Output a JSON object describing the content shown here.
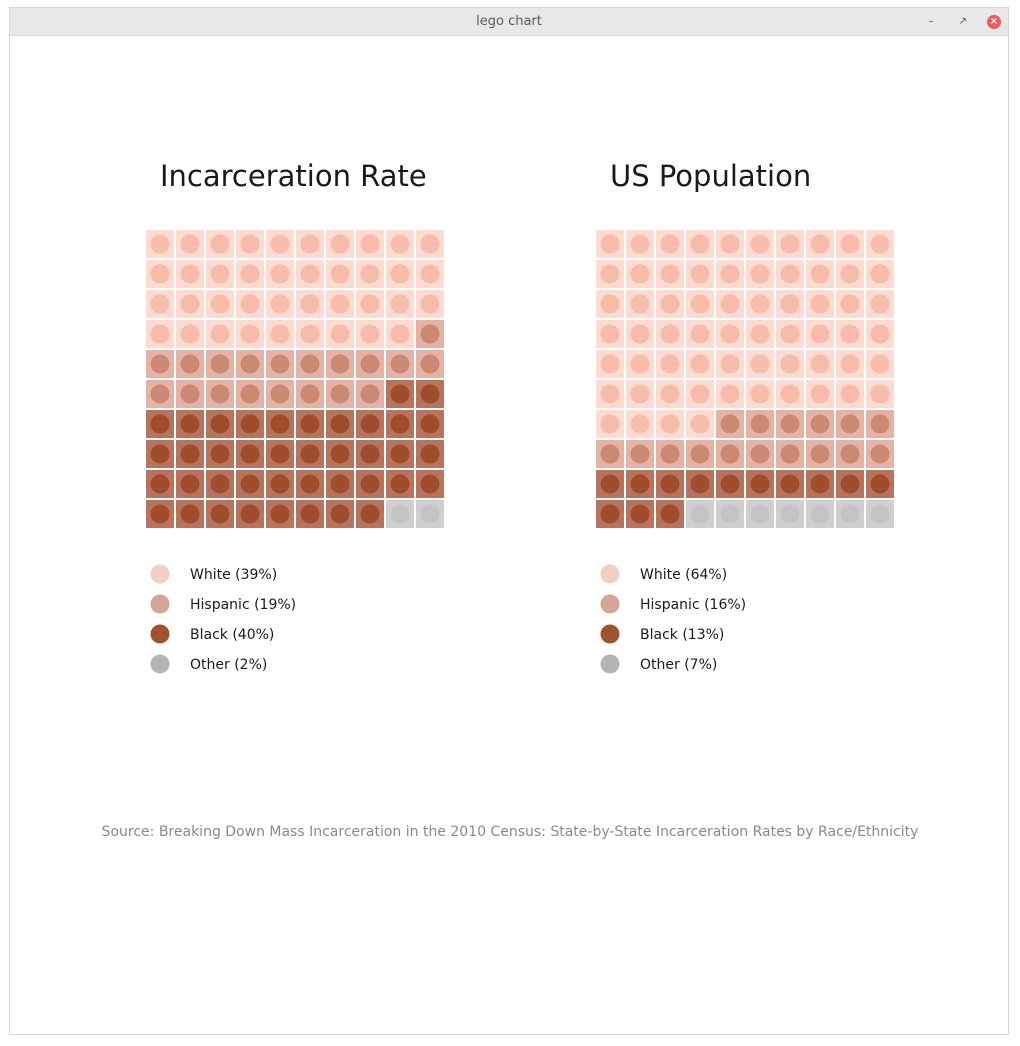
{
  "window": {
    "title": "lego chart",
    "minimize_icon": "minimize-icon",
    "maximize_icon": "restore-icon",
    "close_icon": "close-icon"
  },
  "colors": {
    "White": {
      "tile": "#fddbd0",
      "stud": "#f8bcaa",
      "legend": "#f2cfc5"
    },
    "Hispanic": {
      "tile": "#e5b3a5",
      "stud": "#cd8a72",
      "legend": "#d4a698"
    },
    "Black": {
      "tile": "#b6735e",
      "stud": "#a14c2a",
      "legend": "#a0522d"
    },
    "Other": {
      "tile": "#cfcfcf",
      "stud": "#c4c4c4",
      "legend": "#b4b4b4"
    }
  },
  "chart_data": [
    {
      "type": "waffle",
      "title": "Incarceration Rate",
      "grid": {
        "rows": 10,
        "cols": 10
      },
      "series": [
        {
          "name": "White",
          "label": "White (39%)",
          "value": 39
        },
        {
          "name": "Hispanic",
          "label": "Hispanic (19%)",
          "value": 19
        },
        {
          "name": "Black",
          "label": "Black (40%)",
          "value": 40
        },
        {
          "name": "Other",
          "label": "Other (2%)",
          "value": 2
        }
      ]
    },
    {
      "type": "waffle",
      "title": "US Population",
      "grid": {
        "rows": 10,
        "cols": 10
      },
      "series": [
        {
          "name": "White",
          "label": "White (64%)",
          "value": 64
        },
        {
          "name": "Hispanic",
          "label": "Hispanic (16%)",
          "value": 16
        },
        {
          "name": "Black",
          "label": "Black (13%)",
          "value": 13
        },
        {
          "name": "Other",
          "label": "Other (7%)",
          "value": 7
        }
      ]
    }
  ],
  "source": "Source: Breaking Down Mass Incarceration in the 2010 Census: State-by-State Incarceration Rates by Race/Ethnicity"
}
